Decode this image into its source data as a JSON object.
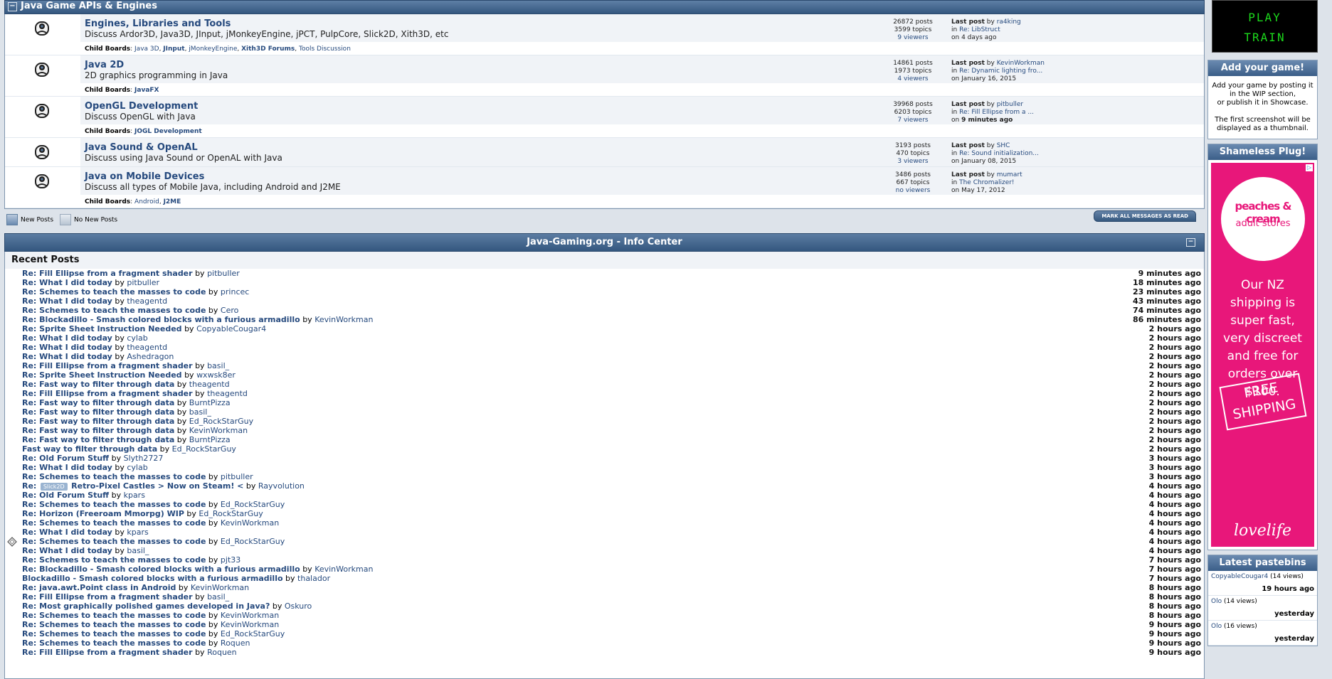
{
  "category": {
    "title": "Java Game APIs & Engines",
    "toggle": "−"
  },
  "boards": [
    {
      "name": "Engines, Libraries and Tools",
      "desc": "Discuss Ardor3D, Java3D, JInput, jMonkeyEngine, jPCT, PulpCore, Slick2D, Xith3D, etc",
      "posts": "26872 posts",
      "topics": "3599 topics",
      "viewers": "9 viewers",
      "lp_label": "Last post",
      "lp_by": "by",
      "lp_user": "ra4king",
      "lp_in": "in",
      "lp_topic": "Re: LibStruct",
      "lp_on": "on",
      "lp_time": "4 days ago",
      "child_label": "Child Boards",
      "children": [
        "Java 3D",
        "JInput",
        "jMonkeyEngine",
        "Xith3D Forums",
        "Tools Discussion"
      ]
    },
    {
      "name": "Java 2D",
      "desc": "2D graphics programming in Java",
      "posts": "14861 posts",
      "topics": "1973 topics",
      "viewers": "4 viewers",
      "lp_label": "Last post",
      "lp_by": "by",
      "lp_user": "KevinWorkman",
      "lp_in": "in",
      "lp_topic": "Re: Dynamic lighting fro...",
      "lp_on": "on",
      "lp_time": "January 16, 2015",
      "child_label": "Child Boards",
      "children": [
        "JavaFX"
      ]
    },
    {
      "name": "OpenGL Development",
      "desc": "Discuss OpenGL with Java",
      "posts": "39968 posts",
      "topics": "6203 topics",
      "viewers": "7 viewers",
      "lp_label": "Last post",
      "lp_by": "by",
      "lp_user": "pitbuller",
      "lp_in": "in",
      "lp_topic": "Re: Fill Ellipse from a ...",
      "lp_on": "on",
      "lp_time": "9 minutes ago",
      "child_label": "Child Boards",
      "children": [
        "JOGL Development"
      ]
    },
    {
      "name": "Java Sound & OpenAL",
      "desc": "Discuss using Java Sound or OpenAL with Java",
      "posts": "3193 posts",
      "topics": "470 topics",
      "viewers": "3 viewers",
      "lp_label": "Last post",
      "lp_by": "by",
      "lp_user": "SHC",
      "lp_in": "in",
      "lp_topic": "Re: Sound initialization...",
      "lp_on": "on",
      "lp_time": "January 08, 2015"
    },
    {
      "name": "Java on Mobile Devices",
      "desc": "Discuss all types of Mobile Java, including Android and J2ME",
      "posts": "3486 posts",
      "topics": "667 topics",
      "viewers": "no viewers",
      "lp_label": "Last post",
      "lp_by": "by",
      "lp_user": "mumart",
      "lp_in": "in",
      "lp_topic": "The Chromalizer!",
      "lp_on": "on",
      "lp_time": "May 17, 2012",
      "child_label": "Child Boards",
      "children": [
        "Android",
        "J2ME"
      ]
    }
  ],
  "legend": {
    "new_posts": "New Posts",
    "no_new_posts": "No New Posts",
    "mark_all": "MARK ALL MESSAGES AS READ"
  },
  "info_center": {
    "title": "Java-Gaming.org - Info Center",
    "toggle": "−",
    "recent_title": "Recent Posts",
    "by": "by",
    "posts": [
      {
        "t": "Re: Fill Ellipse from a fragment shader",
        "u": "pitbuller",
        "time": "9 minutes ago"
      },
      {
        "t": "Re: What I did today",
        "u": "pitbuller",
        "time": "18 minutes ago"
      },
      {
        "t": "Re: Schemes to teach the masses to code",
        "u": "princec",
        "time": "23 minutes ago"
      },
      {
        "t": "Re: What I did today",
        "u": "theagentd",
        "time": "43 minutes ago"
      },
      {
        "t": "Re: Schemes to teach the masses to code",
        "u": "Cero",
        "time": "74 minutes ago"
      },
      {
        "t": "Re: Blockadillo - Smash colored blocks with a furious armadillo",
        "u": "KevinWorkman",
        "time": "86 minutes ago"
      },
      {
        "t": "Re: Sprite Sheet Instruction Needed",
        "u": "CopyableCougar4",
        "time": "2 hours ago"
      },
      {
        "t": "Re: What I did today",
        "u": "cylab",
        "time": "2 hours ago"
      },
      {
        "t": "Re: What I did today",
        "u": "theagentd",
        "time": "2 hours ago"
      },
      {
        "t": "Re: What I did today",
        "u": "Ashedragon",
        "time": "2 hours ago"
      },
      {
        "t": "Re: Fill Ellipse from a fragment shader",
        "u": "basil_",
        "time": "2 hours ago"
      },
      {
        "t": "Re: Sprite Sheet Instruction Needed",
        "u": "wxwsk8er",
        "time": "2 hours ago"
      },
      {
        "t": "Re: Fast way to filter through data",
        "u": "theagentd",
        "time": "2 hours ago"
      },
      {
        "t": "Re: Fill Ellipse from a fragment shader",
        "u": "theagentd",
        "time": "2 hours ago"
      },
      {
        "t": "Re: Fast way to filter through data",
        "u": "BurntPizza",
        "time": "2 hours ago"
      },
      {
        "t": "Re: Fast way to filter through data",
        "u": "basil_",
        "time": "2 hours ago"
      },
      {
        "t": "Re: Fast way to filter through data",
        "u": "Ed_RockStarGuy",
        "time": "2 hours ago"
      },
      {
        "t": "Re: Fast way to filter through data",
        "u": "KevinWorkman",
        "time": "2 hours ago"
      },
      {
        "t": "Re: Fast way to filter through data",
        "u": "BurntPizza",
        "time": "2 hours ago"
      },
      {
        "t": "Fast way to filter through data",
        "u": "Ed_RockStarGuy",
        "time": "2 hours ago"
      },
      {
        "t": "Re: Old Forum Stuff",
        "u": "Slyth2727",
        "time": "3 hours ago"
      },
      {
        "t": "Re: What I did today",
        "u": "cylab",
        "time": "3 hours ago"
      },
      {
        "t": "Re: Schemes to teach the masses to code",
        "u": "pitbuller",
        "time": "3 hours ago"
      },
      {
        "t": "Retro-Pixel Castles > Now on Steam! <",
        "pre": "Re:",
        "tag": "Slick2D",
        "u": "Rayvolution",
        "time": "4 hours ago"
      },
      {
        "t": "Re: Old Forum Stuff",
        "u": "kpars",
        "time": "4 hours ago"
      },
      {
        "t": "Re: Schemes to teach the masses to code",
        "u": "Ed_RockStarGuy",
        "time": "4 hours ago"
      },
      {
        "t": "Re: Horizon (Freeroam Mmorpg) WIP",
        "u": "Ed_RockStarGuy",
        "time": "4 hours ago"
      },
      {
        "t": "Re: Schemes to teach the masses to code",
        "u": "KevinWorkman",
        "time": "4 hours ago"
      },
      {
        "t": "Re: What I did today",
        "u": "kpars",
        "time": "4 hours ago"
      },
      {
        "t": "Re: Schemes to teach the masses to code",
        "u": "Ed_RockStarGuy",
        "time": "4 hours ago"
      },
      {
        "t": "Re: What I did today",
        "u": "basil_",
        "time": "4 hours ago"
      },
      {
        "t": "Re: Schemes to teach the masses to code",
        "u": "pjt33",
        "time": "7 hours ago"
      },
      {
        "t": "Re: Blockadillo - Smash colored blocks with a furious armadillo",
        "u": "KevinWorkman",
        "time": "7 hours ago"
      },
      {
        "t": "Blockadillo - Smash colored blocks with a furious armadillo",
        "u": "thalador",
        "time": "7 hours ago"
      },
      {
        "t": "Re: java.awt.Point class in Android",
        "u": "KevinWorkman",
        "time": "8 hours ago"
      },
      {
        "t": "Re: Fill Ellipse from a fragment shader",
        "u": "basil_",
        "time": "8 hours ago"
      },
      {
        "t": "Re: Most graphically polished games developed in Java?",
        "u": "Oskuro",
        "time": "8 hours ago"
      },
      {
        "t": "Re: Schemes to teach the masses to code",
        "u": "KevinWorkman",
        "time": "8 hours ago"
      },
      {
        "t": "Re: Schemes to teach the masses to code",
        "u": "KevinWorkman",
        "time": "9 hours ago"
      },
      {
        "t": "Re: Schemes to teach the masses to code",
        "u": "Ed_RockStarGuy",
        "time": "9 hours ago"
      },
      {
        "t": "Re: Schemes to teach the masses to code",
        "u": "Roquen",
        "time": "9 hours ago"
      },
      {
        "t": "Re: Fill Ellipse from a fragment shader",
        "u": "Roquen",
        "time": "9 hours ago"
      }
    ]
  },
  "sidebar": {
    "play": {
      "line1": "PLAY",
      "line2": "TRAIN"
    },
    "add_game": {
      "title": "Add your game!",
      "text1": "Add your game by posting it in the WIP section,",
      "text2": "or publish it in Showcase.",
      "text3": "The first screenshot will be displayed as a thumbnail."
    },
    "plug": {
      "title": "Shameless Plug!",
      "ad_logo1": "peaches & cream",
      "ad_logo2": "adult stores",
      "ad_text": "Our NZ shipping is super fast, very discreet and free for orders over $100.",
      "ad_badge": "FREE SHIPPING",
      "ad_brand": "lovelife",
      "ad_corner": "▷"
    },
    "pastebins": {
      "title": "Latest pastebins",
      "items": [
        {
          "who": "CopyableCougar4",
          "views": "(14 views)",
          "when": "19 hours ago"
        },
        {
          "who": "Olo",
          "views": "(14 views)",
          "when": "yesterday"
        },
        {
          "who": "Olo",
          "views": "(16 views)",
          "when": "yesterday"
        }
      ]
    }
  }
}
